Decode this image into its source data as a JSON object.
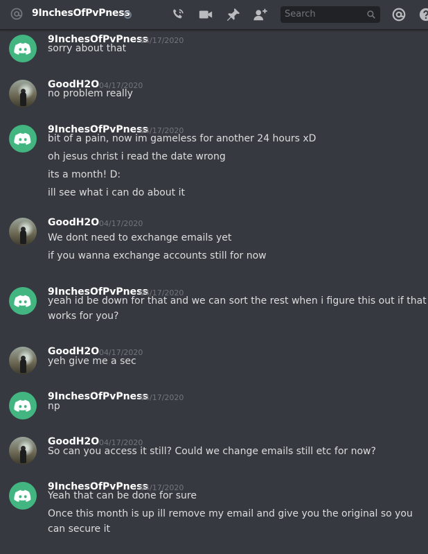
{
  "header": {
    "channel_title": "9InchesOfPvPness",
    "search_placeholder": "Search",
    "icons": [
      "at-icon",
      "status-offline-icon",
      "call-icon",
      "video-icon",
      "pin-icon",
      "add-user-icon",
      "search-icon",
      "mention-icon",
      "help-icon"
    ]
  },
  "messages": [
    {
      "author": "9InchesOfPvPness",
      "timestamp": "04/17/2020",
      "avatar": "discord",
      "lines": [
        "sorry about that"
      ]
    },
    {
      "author": "GoodH2O",
      "timestamp": "04/17/2020",
      "avatar": "photo",
      "lines": [
        "no problem really"
      ]
    },
    {
      "author": "9InchesOfPvPness",
      "timestamp": "04/17/2020",
      "avatar": "discord",
      "lines": [
        "bit of a pain, now im gameless for another 24 hours xD",
        "oh jesus christ i read the date wrong",
        "its a month! D:",
        "ill see what i can do about it"
      ]
    },
    {
      "author": "GoodH2O",
      "timestamp": "04/17/2020",
      "avatar": "photo",
      "lines": [
        "We dont need to exchange emails yet",
        "if you wanna exchange accounts still for now"
      ]
    },
    {
      "author": "9InchesOfPvPness",
      "timestamp": "04/17/2020",
      "avatar": "discord",
      "lines": [
        "yeah id be down for that and we can sort the rest when i figure this out if that",
        "works for you?"
      ]
    },
    {
      "author": "GoodH2O",
      "timestamp": "04/17/2020",
      "avatar": "photo",
      "lines": [
        "yeh give me a sec"
      ]
    },
    {
      "author": "9InchesOfPvPness",
      "timestamp": "04/17/2020",
      "avatar": "discord",
      "lines": [
        "np"
      ]
    },
    {
      "author": "GoodH2O",
      "timestamp": "04/17/2020",
      "avatar": "photo",
      "lines": [
        "So can you access it still? Could we change emails still etc for now?"
      ]
    },
    {
      "author": "9InchesOfPvPness",
      "timestamp": "04/17/2020",
      "avatar": "discord",
      "lines": [
        "Yeah that can be done for sure",
        "Once this month is up ill remove my email and give you the original so you",
        "can secure it"
      ]
    }
  ]
}
